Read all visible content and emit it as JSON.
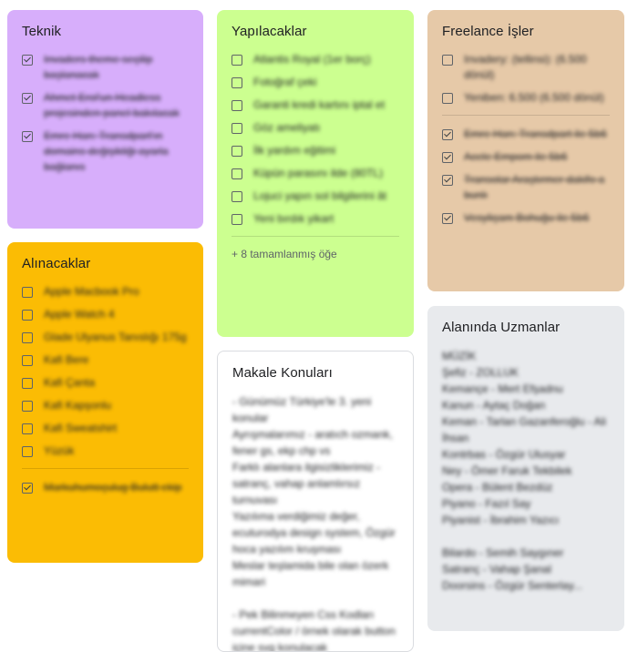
{
  "notes": {
    "teknik": {
      "title": "Teknik",
      "items": [
        {
          "text": "Invaders theme seçilip başlanacak",
          "checked": true
        },
        {
          "text": "Ahmet Erol'un Headless projesinden panel bakılacak",
          "checked": true
        },
        {
          "text": "Emre Han: Transdpart'ın domains değişikliği ayarla bağlanıs",
          "checked": true
        }
      ]
    },
    "alinacaklar": {
      "title": "Alınacaklar",
      "items": [
        {
          "text": "Apple Macbook Pro",
          "checked": false
        },
        {
          "text": "Apple Watch 4",
          "checked": false
        },
        {
          "text": "Glade Ulyanus Tanıslığı 175g",
          "checked": false
        },
        {
          "text": "Kafi Bere",
          "checked": false
        },
        {
          "text": "Kafi Çanta",
          "checked": false
        },
        {
          "text": "Kafi Kapşonlu",
          "checked": false
        },
        {
          "text": "Kafi Sweatshirt",
          "checked": false
        },
        {
          "text": "Yüzük",
          "checked": false
        }
      ],
      "checked_items": [
        {
          "text": "Markuhumoçulug Bulutt ekip",
          "checked": true
        }
      ]
    },
    "yapilacaklar": {
      "title": "Yapılacaklar",
      "items": [
        {
          "text": "Atlantis Royal (1er borç)",
          "checked": false
        },
        {
          "text": "Fotoğraf çeki",
          "checked": false
        },
        {
          "text": "Garanti kredi kartını iptal et",
          "checked": false
        },
        {
          "text": "Göz ameliyatı",
          "checked": false
        },
        {
          "text": "İlk yardım eğitimi",
          "checked": false
        },
        {
          "text": "Küpün parasını ilde (80TL)",
          "checked": false
        },
        {
          "text": "Lojuci yapın sol bilgilerini ât",
          "checked": false
        },
        {
          "text": "Yeni bırdık yikart",
          "checked": false
        }
      ],
      "completed_label": "+ 8 tamamlanmış öğe"
    },
    "makale": {
      "title": "Makale Konuları",
      "body": "- Günümüz Türkiye'le 3. yeni konular\nAyrışmalarımız - aratıch ozmank, fener gs, ekp chp vs\nFarklı alanlara ilgisizliklerimiz - satranç, vahap anlamlırsız turnuvası\nYazılıma verdiğimiz değer, ecuturodya design system, Özgür hoca yazılım kruşması\nMeslar teşlamida bile olan özerk mimari\n\n- Pek Bilinmeyen Css Kodları currentColor / örnek olarak button içine svg konulacak"
    },
    "freelance": {
      "title": "Freelance İşler",
      "items": [
        {
          "text": "Invadery: (tellinsi): (6.500 dönül)",
          "checked": false
        },
        {
          "text": "Yeniben: 6.500 (6.500 dönül)",
          "checked": false
        }
      ],
      "checked_items": [
        {
          "text": "Emre Han: Transdpart ile 5b6",
          "checked": true
        },
        {
          "text": "Acele Empom ile 5b6",
          "checked": true
        },
        {
          "text": "Transolar Araştırmer dakifo a bunlı",
          "checked": true
        },
        {
          "text": "Vesyliçam Bohuğu ile 5b6",
          "checked": true
        }
      ]
    },
    "uzman": {
      "title": "Alanında Uzmanlar",
      "body": "MÜZİK\nŞefiz - ZOLLUK\nKemançe - Mert Efşadnu\nKanun - Aytaç Doğan\nKeman - Tarlan Gazanferoğlu - Ali İhsan\nKontrbas - Özgür Ulusyar\nNey - Ömer Faruk Tekbilek\nOpera - Bülent Bezdüz\nPiyano - Fazıl Say\nPiyanist - İbrahim Yazıcı\n\nBilardo - Semih Saygıner\nSatranç - Vahap Şanal\nDoorsins - Özgür Senterlay..."
    }
  },
  "colors": {
    "teknik": "#d7aefb",
    "alinacaklar": "#fbbc04",
    "yapilacaklar": "#ccff90",
    "makale": "#ffffff",
    "freelance": "#e6c9a8",
    "uzman": "#e8eaed"
  },
  "icons": {
    "checkbox": "checkbox-icon",
    "checkbox_checked": "checkbox-checked-icon"
  }
}
